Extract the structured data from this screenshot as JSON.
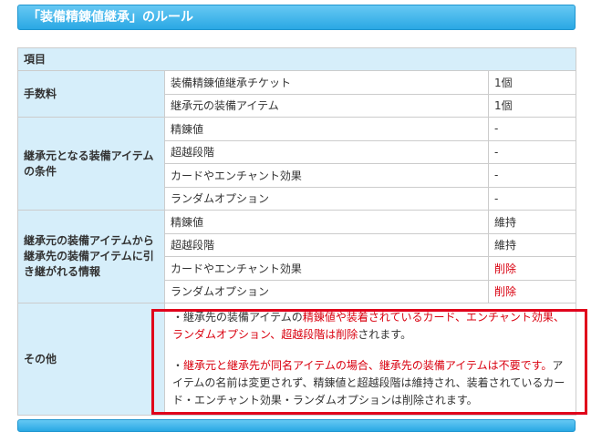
{
  "title": "「装備精錬値継承」のルール",
  "table": {
    "header": "項目",
    "fee": {
      "label": "手数料",
      "rows": [
        {
          "item": "装備精錬値継承チケット",
          "value": "1個"
        },
        {
          "item": "継承元の装備アイテム",
          "value": "1個"
        }
      ]
    },
    "condition": {
      "label": "継承元となる装備アイテムの条件",
      "rows": [
        {
          "item": "精錬値",
          "value": "-"
        },
        {
          "item": "超越段階",
          "value": "-"
        },
        {
          "item": "カードやエンチャント効果",
          "value": "-"
        },
        {
          "item": "ランダムオプション",
          "value": "-"
        }
      ]
    },
    "inherited": {
      "label": "継承元の装備アイテムから継承先の装備アイテムに引き継がれる情報",
      "rows": [
        {
          "item": "精錬値",
          "value": "維持"
        },
        {
          "item": "超越段階",
          "value": "維持"
        },
        {
          "item": "カードやエンチャント効果",
          "value": "削除"
        },
        {
          "item": "ランダムオプション",
          "value": "削除"
        }
      ]
    },
    "other": {
      "label": "その他",
      "note1_a": "・継承先の装備アイテムの",
      "note1_b": "精錬値や装着されているカード、エンチャント効果、ランダムオプション、超越段階は削除",
      "note1_c": "されます。",
      "note2_a": "・",
      "note2_b": "継承元と継承先が同名アイテムの場合、継承先の装備アイテムは不要です。",
      "note2_c": "アイテムの名前は変更されず、精錬値と超越段階は維持され、装着されているカード・エンチャント効果・ランダムオプションは削除されます。"
    }
  },
  "colors": {
    "accent_blue": "#2aa8e4",
    "header_bg": "#d6eefa",
    "warning_red": "#d9000f",
    "highlight_red": "#e0001b"
  }
}
